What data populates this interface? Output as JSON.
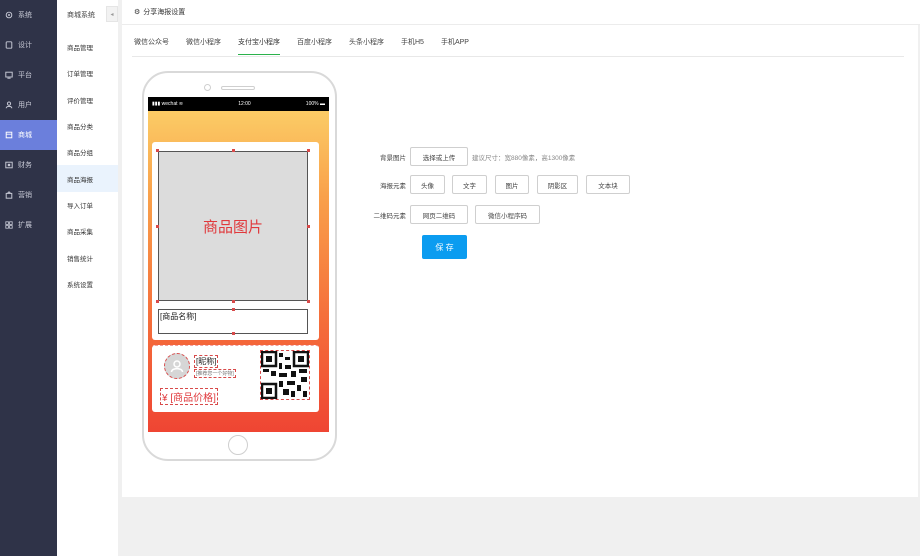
{
  "sidebar": {
    "items": [
      {
        "label": "系统",
        "icon": "settings-icon"
      },
      {
        "label": "设计",
        "icon": "design-icon"
      },
      {
        "label": "平台",
        "icon": "platform-icon"
      },
      {
        "label": "用户",
        "icon": "user-icon"
      },
      {
        "label": "商城",
        "icon": "mall-icon"
      },
      {
        "label": "财务",
        "icon": "finance-icon"
      },
      {
        "label": "营销",
        "icon": "marketing-icon"
      },
      {
        "label": "扩展",
        "icon": "extend-icon"
      }
    ],
    "active_index": 4
  },
  "submenu": {
    "title": "商城系统",
    "collapse_icon": "chevron-left-icon",
    "items": [
      "商品管理",
      "订单管理",
      "评价管理",
      "商品分类",
      "商品分组",
      "商品海报",
      "导入订单",
      "商品采集",
      "销售统计",
      "系统设置"
    ],
    "active_index": 5
  },
  "header": {
    "title": "分享海报设置",
    "icon": "gear-icon"
  },
  "tabs": {
    "items": [
      "微信公众号",
      "微信小程序",
      "支付宝小程序",
      "百度小程序",
      "头条小程序",
      "手机H5",
      "手机APP"
    ],
    "active_index": 2,
    "active_color": "#2bb24c"
  },
  "phone": {
    "status": {
      "carrier": "wechat",
      "time": "12:00",
      "battery": "100%"
    },
    "product_image_text": "商品图片",
    "product_name_text": "[商品名称]",
    "nickname_text": "[昵称]",
    "tagline_text": "[推荐您一个好物]",
    "price_text": "¥ [商品价格]"
  },
  "form": {
    "bg_label": "背景图片",
    "bg_button": "选择或上传",
    "bg_hint": "建议尺寸：宽880像素，高1300像素",
    "elements_label": "海报元素",
    "elements": [
      "头像",
      "文字",
      "图片",
      "阴影区",
      "文本块"
    ],
    "qr_label": "二维码元素",
    "qr_buttons": [
      "网页二维码",
      "微信小程序码"
    ],
    "save_label": "保 存",
    "save_color": "#0b9cf0"
  }
}
